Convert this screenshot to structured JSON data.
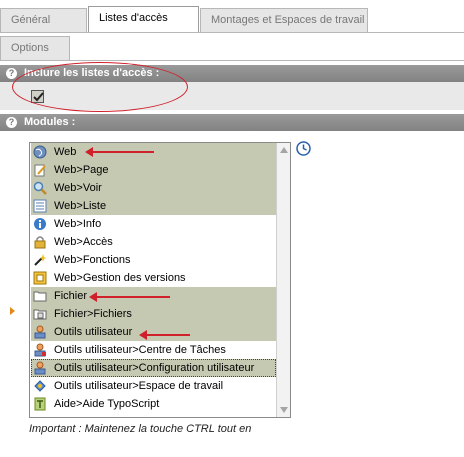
{
  "tabs": [
    {
      "label": "Général",
      "active": false
    },
    {
      "label": "Listes d'accès",
      "active": true
    },
    {
      "label": "Montages et Espaces de travail",
      "active": false
    }
  ],
  "tabs_row2": [
    {
      "label": "Options",
      "active": false
    }
  ],
  "section_access": {
    "help_glyph": "?",
    "title": "Inclure les listes d'accès :",
    "checked": true
  },
  "section_modules": {
    "help_glyph": "?",
    "title": "Modules :"
  },
  "modules": [
    {
      "label": "Web",
      "selected": true,
      "icon": "globe-icon"
    },
    {
      "label": "Web>Page",
      "selected": true,
      "icon": "page-edit-icon"
    },
    {
      "label": "Web>Voir",
      "selected": true,
      "icon": "magnifier-icon"
    },
    {
      "label": "Web>Liste",
      "selected": true,
      "icon": "list-icon"
    },
    {
      "label": "Web>Info",
      "selected": false,
      "icon": "info-icon"
    },
    {
      "label": "Web>Accès",
      "selected": false,
      "icon": "lock-icon"
    },
    {
      "label": "Web>Fonctions",
      "selected": false,
      "icon": "wand-icon"
    },
    {
      "label": "Web>Gestion des versions",
      "selected": false,
      "icon": "versions-icon"
    },
    {
      "label": "Fichier",
      "selected": true,
      "icon": "folder-icon"
    },
    {
      "label": "Fichier>Fichiers",
      "selected": true,
      "icon": "files-icon"
    },
    {
      "label": "Outils utilisateur",
      "selected": true,
      "icon": "user-tools-icon"
    },
    {
      "label": "Outils utilisateur>Centre de Tâches",
      "selected": false,
      "icon": "task-center-icon"
    },
    {
      "label": "Outils utilisateur>Configuration utilisateur",
      "selected": true,
      "focused": true,
      "icon": "user-config-icon"
    },
    {
      "label": "Outils utilisateur>Espace de travail",
      "selected": false,
      "icon": "workspace-icon"
    },
    {
      "label": "Aide>Aide TypoScript",
      "selected": false,
      "icon": "typoscript-help-icon"
    }
  ],
  "footnote": "Important : Maintenez la touche CTRL tout en",
  "colors": {
    "section_bg": "#8b8b8b",
    "selected_item_bg": "#c5c9b2",
    "annotation_red": "#d0202a",
    "tab_inactive_bg": "#e6e6e6"
  }
}
